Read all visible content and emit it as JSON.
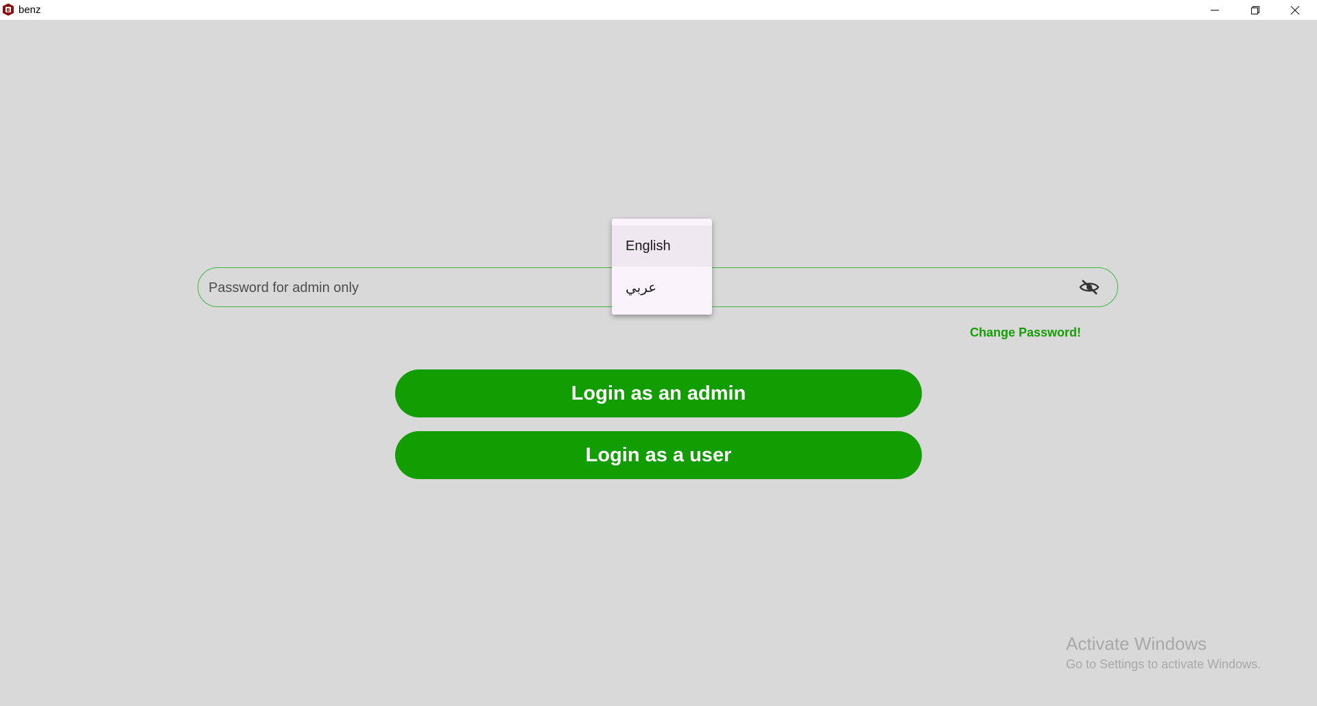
{
  "window": {
    "title": "benz",
    "icon": "benz-app-icon",
    "controls": [
      "minimize-icon",
      "restore-icon",
      "close-icon"
    ]
  },
  "password": {
    "placeholder": "Password for admin only",
    "value": "",
    "visibility_icon": "eye-slash-icon"
  },
  "change_password_label": "Change Password!",
  "buttons": {
    "admin": "Login as an admin",
    "user": "Login as a user"
  },
  "language_menu": {
    "options": [
      "English",
      "عربي"
    ],
    "highlighted": "English"
  },
  "watermark": {
    "title": "Activate Windows",
    "subtitle": "Go to Settings to activate Windows."
  },
  "colors": {
    "background": "#d9d9d9",
    "accent_green": "#129e02",
    "field_border": "#3cb83c",
    "menu_bg": "#faf3fb"
  }
}
